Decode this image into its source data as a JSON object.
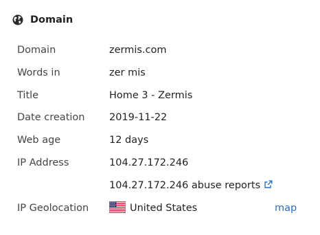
{
  "panel": {
    "icon": "globe-icon",
    "title": "Domain"
  },
  "rows": {
    "domain": {
      "label": "Domain",
      "value": "zermis.com"
    },
    "words": {
      "label": "Words in",
      "value": "zer mis"
    },
    "title": {
      "label": "Title",
      "value": "Home 3 - Zermis"
    },
    "date_creation": {
      "label": "Date creation",
      "value": "2019-11-22"
    },
    "web_age": {
      "label": "Web age",
      "value": "12 days"
    },
    "ip_address": {
      "label": "IP Address",
      "value": "104.27.172.246"
    },
    "abuse": {
      "value": "104.27.172.246 abuse reports",
      "icon": "external-link-icon"
    },
    "geolocation": {
      "label": "IP Geolocation",
      "flag_icon": "us-flag-icon",
      "value": "United States",
      "map_label": "map"
    }
  },
  "colors": {
    "link": "#2a6ebb",
    "text": "#222222",
    "label": "#444444"
  }
}
